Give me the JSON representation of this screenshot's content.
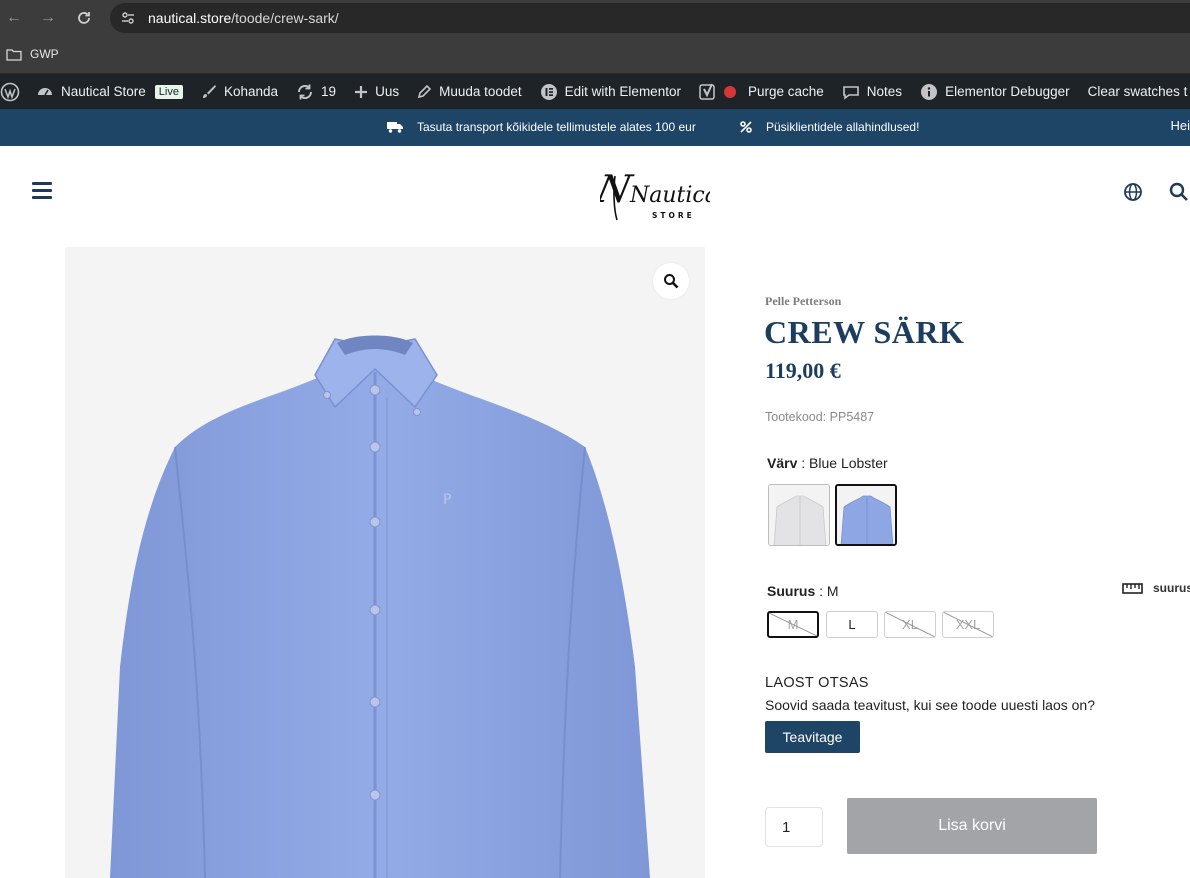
{
  "browser": {
    "url_host": "nautical.store",
    "url_path": "/toode/crew-sark/",
    "bookmarks": [
      {
        "label": "GWP"
      }
    ]
  },
  "admin_bar": {
    "site_name": "Nautical Store",
    "live_badge": "Live",
    "customize": "Kohanda",
    "updates_count": "19",
    "new_label": "Uus",
    "edit_products": "Muuda toodet",
    "edit_elementor": "Edit with Elementor",
    "purge_cache": "Purge cache",
    "notes": "Notes",
    "elementor_debugger": "Elementor Debugger",
    "clear_swatches": "Clear swatches t"
  },
  "promo_bar": {
    "shipping": "Tasuta transport kõikidele tellimustele alates 100 eur",
    "discount": "Püsiklientidele allahindlused!",
    "right_text": "Hei"
  },
  "header": {
    "logo_script": "Nautical",
    "logo_sub": "STORE"
  },
  "product": {
    "brand": "Pelle Petterson",
    "title": "CREW SÄRK",
    "price": "119,00 €",
    "sku_label": "Tootekood:",
    "sku_value": "PP5487",
    "color_label": "Värv",
    "color_value": ": Blue Lobster",
    "color_swatches": [
      {
        "name": "white-shirt",
        "color": "#e9e9ea",
        "selected": false
      },
      {
        "name": "blue-lobster-shirt",
        "color": "#8fa6e4",
        "selected": true
      }
    ],
    "size_label": "Suurus",
    "size_value": ": M",
    "sizes": [
      {
        "label": "M",
        "selected": true,
        "out_of_stock": true
      },
      {
        "label": "L",
        "selected": false,
        "out_of_stock": false
      },
      {
        "label": "XL",
        "selected": false,
        "out_of_stock": true
      },
      {
        "label": "XXL",
        "selected": false,
        "out_of_stock": true
      }
    ],
    "size_guide_label": "suurus",
    "stock_title": "LAOST OTSAS",
    "stock_text": "Soovid saada teavitust, kui see toode uuesti laos on?",
    "notify_button": "Teavitage",
    "quantity": "1",
    "add_to_cart": "Lisa korvi"
  },
  "colors": {
    "brand_navy": "#1e4466",
    "title_navy": "#1c3d5e",
    "shirt_blue": "#8fa6e4"
  }
}
